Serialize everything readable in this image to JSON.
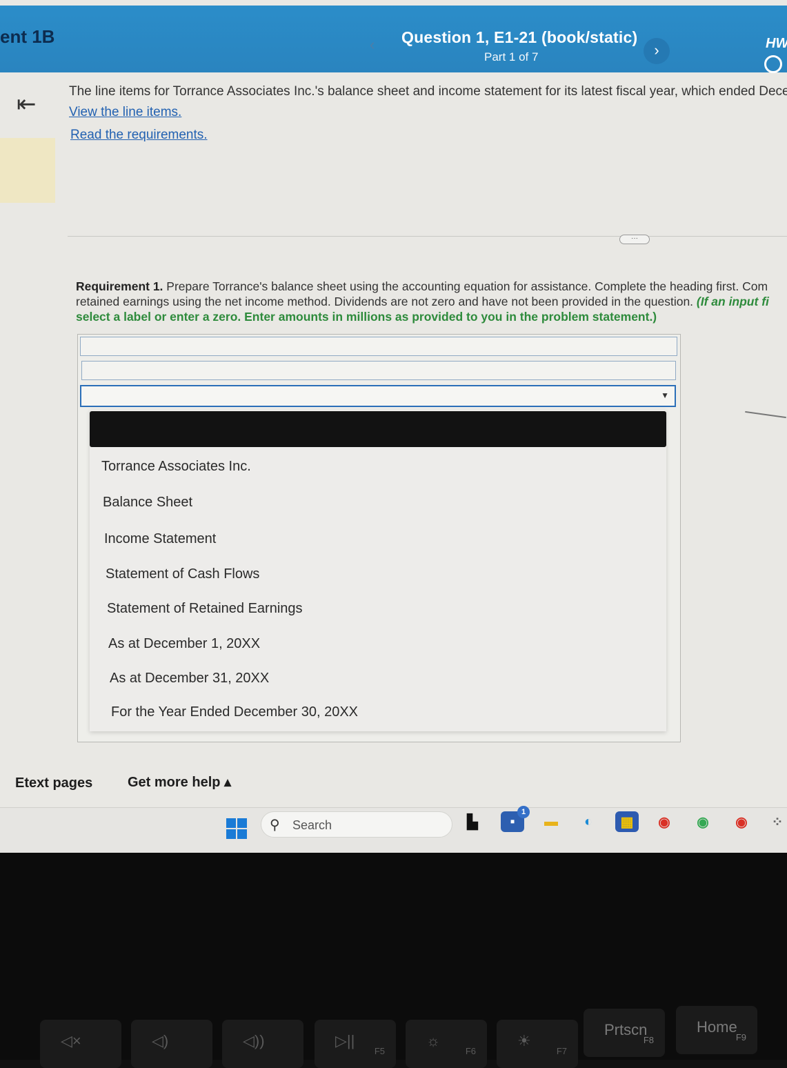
{
  "header": {
    "assignment_title": "ent 1B",
    "question_title": "Question 1, E1-21 (book/static)",
    "part": "Part 1 of 7",
    "prev_symbol": "‹",
    "next_symbol": "›",
    "hw_label": "HW"
  },
  "problem": {
    "intro": "The line items for Torrance Associates Inc.'s balance sheet and income statement for its latest fiscal year, which ended Decemb",
    "link_line_items": "View the line items.",
    "link_requirements": "Read the requirements.",
    "more_label": "···"
  },
  "requirement": {
    "label": "Requirement 1.",
    "text1": " Prepare Torrance's balance sheet using the accounting equation for assistance. Complete the heading first. Com",
    "text2": "retained earnings using the net income method. Dividends are not zero and have not been provided in the question. ",
    "green_italic": "(If an input fi",
    "green": "select a label or enter a zero. Enter amounts in millions as provided to you in the problem statement.)"
  },
  "dropdown": {
    "selected": "",
    "options": [
      "Torrance Associates Inc.",
      "Balance Sheet",
      "Income Statement",
      "Statement of Cash Flows",
      "Statement of Retained Earnings",
      "As at December 1, 20XX",
      "As at December 31, 20XX",
      "For the Year Ended December 30, 20XX"
    ]
  },
  "footer": {
    "etext": "Etext pages",
    "help": "Get more help ▴"
  },
  "taskbar": {
    "search_placeholder": "Search",
    "badge": "1"
  },
  "keyboard": {
    "keys": [
      {
        "top": "◁×",
        "fn": ""
      },
      {
        "top": "◁)",
        "fn": ""
      },
      {
        "top": "◁))",
        "fn": ""
      },
      {
        "top": "▷||",
        "fn": "F5"
      },
      {
        "top": "☼",
        "fn": "F6"
      },
      {
        "top": "☀",
        "fn": "F7"
      },
      {
        "top": "Prtscn",
        "fn": "F8"
      },
      {
        "top": "Home",
        "fn": "F9"
      }
    ]
  }
}
